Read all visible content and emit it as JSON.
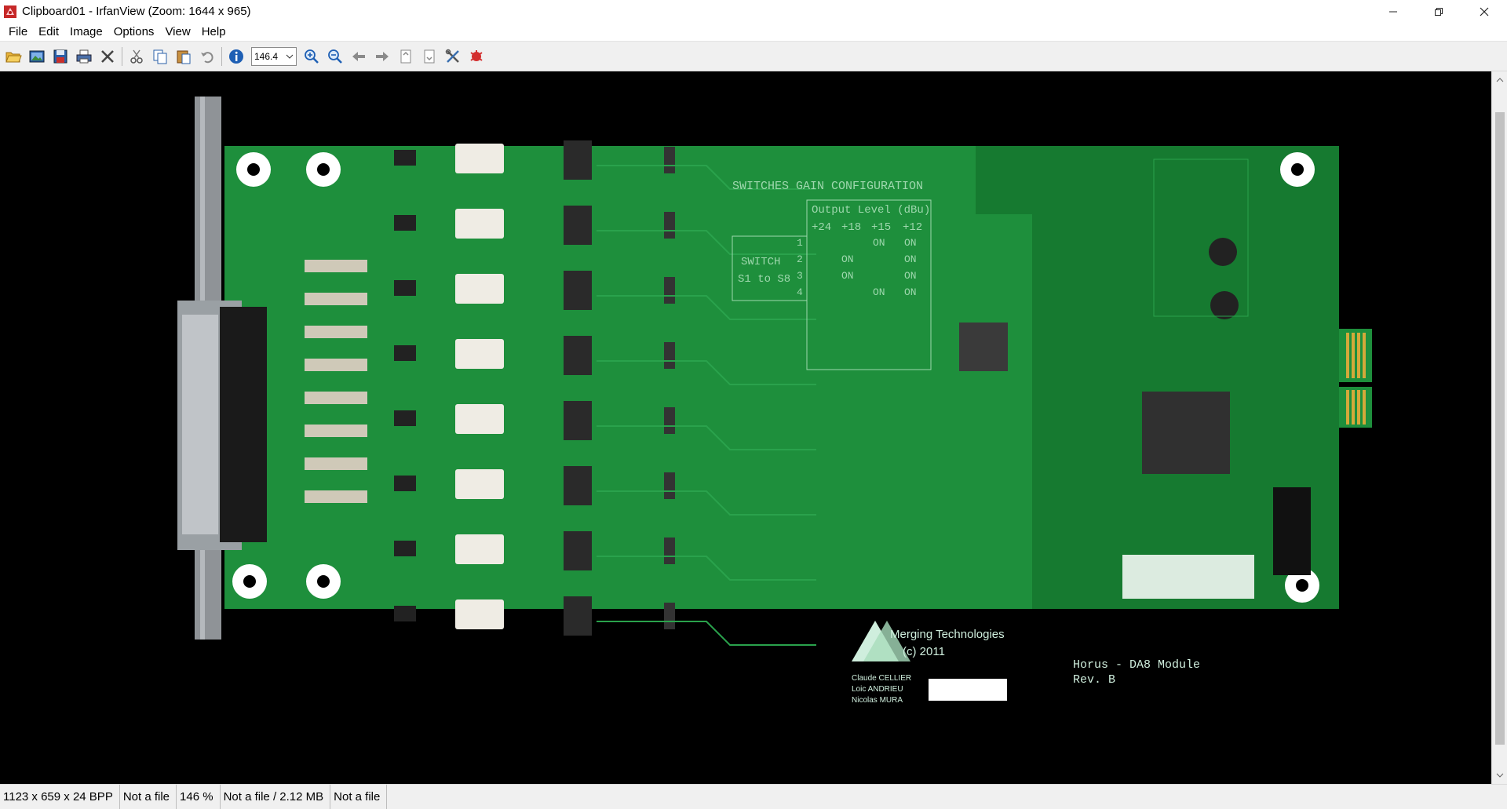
{
  "window": {
    "title": "Clipboard01 - IrfanView (Zoom: 1644 x 965)",
    "app_icon": "irfanview-icon",
    "controls": {
      "minimize": "—",
      "restore": "❐",
      "close": "✕"
    }
  },
  "menu": {
    "items": [
      "File",
      "Edit",
      "Image",
      "Options",
      "View",
      "Help"
    ]
  },
  "toolbar": {
    "zoom_value": "146.4",
    "buttons": [
      "open-icon",
      "thumbnails-icon",
      "save-icon",
      "print-icon",
      "delete-icon",
      "cut-icon",
      "copy-icon",
      "paste-icon",
      "undo-icon",
      "info-icon",
      "zoom-in-icon",
      "zoom-out-icon",
      "previous-icon",
      "next-icon",
      "first-page-icon",
      "last-page-icon",
      "settings-icon",
      "exit-icon"
    ]
  },
  "image": {
    "description_text": {
      "switch_title": "SWITCHES GAIN CONFIGURATION",
      "output_level": "Output Level (dBu)",
      "levels": [
        "+24",
        "+18",
        "+15",
        "+12"
      ],
      "switch_label": "SWITCH",
      "switch_range": "S1 to S8",
      "rows": [
        {
          "n": "1",
          "cells": [
            "",
            "",
            "ON",
            "ON"
          ]
        },
        {
          "n": "2",
          "cells": [
            "",
            "ON",
            "",
            "ON"
          ]
        },
        {
          "n": "3",
          "cells": [
            "",
            "ON",
            "",
            "ON"
          ]
        },
        {
          "n": "4",
          "cells": [
            "",
            "",
            "ON",
            "ON"
          ]
        }
      ],
      "company": "Merging Technologies",
      "copyright": "(c) 2011",
      "authors": [
        "Claude CELLIER",
        "Loic ANDRIEU",
        "Nicolas MURA"
      ],
      "module_name": "Horus - DA8 Module",
      "revision": "Rev. B"
    },
    "colors": {
      "pcb": "#1e8f3c",
      "pcb_dark": "#167a30",
      "background": "#000000"
    }
  },
  "status": {
    "dimensions": "1123 x 659 x 24 BPP",
    "file1": "Not a file",
    "zoom": "146 %",
    "size": "Not a file / 2.12 MB",
    "file2": "Not a file"
  }
}
